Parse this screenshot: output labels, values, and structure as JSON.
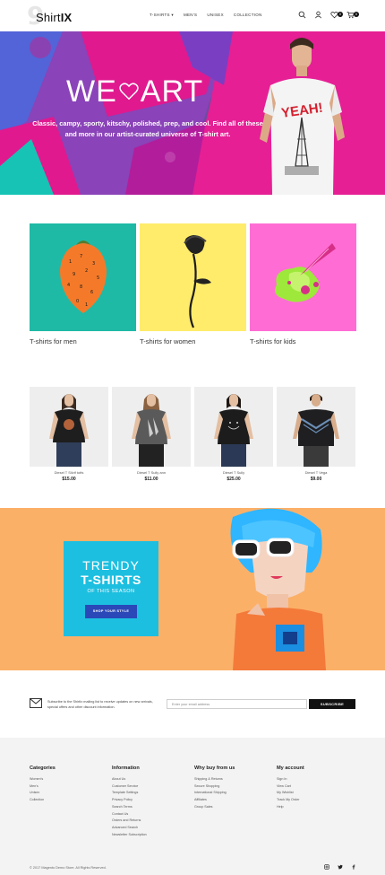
{
  "header": {
    "logo_number": "9",
    "logo_name": "Shirt",
    "logo_suffix": "IX",
    "nav": [
      "T-shirts",
      "Men's",
      "Unisex",
      "Collection"
    ],
    "cart_count": "0",
    "wishlist_count": "0"
  },
  "hero": {
    "title_left": "WE",
    "title_right": "ART",
    "text": "Classic, campy, sporty, kitschy, polished, prep, and cool. Find all of these and more in our artist-curated universe of T-shirt art.",
    "shirt_print": "YEAH!"
  },
  "categories": [
    {
      "label": "T-shirts for men"
    },
    {
      "label": "T-shirts for women"
    },
    {
      "label": "T-shirts for kids"
    }
  ],
  "products": [
    {
      "name": "Diesel T Silvif totfs",
      "price": "$15.00"
    },
    {
      "name": "Diesel T Sully ann",
      "price": "$11.00"
    },
    {
      "name": "Diesel T Sully",
      "price": "$25.00"
    },
    {
      "name": "Diesel T Vega",
      "price": "$9.00"
    }
  ],
  "promo": {
    "line1": "TRENDY",
    "line2": "T-SHIRTS",
    "line3": "OF THIS SEASON",
    "button": "SHOP YOUR STYLE"
  },
  "newsletter": {
    "text": "Subscribe to the ShirtIx mailing list to receive updates on new arrivals, special offers and other discount information.",
    "placeholder": "Enter your email address",
    "button": "SUBSCRIBE"
  },
  "footer": {
    "columns": [
      {
        "title": "Categories",
        "items": [
          "Women's",
          "Men's",
          "Unisex",
          "Collection"
        ]
      },
      {
        "title": "Information",
        "items": [
          "About Us",
          "Customer Service",
          "Template Settings",
          "Privacy Policy",
          "Search Terms",
          "Contact Us",
          "Orders and Returns",
          "Advanced Search",
          "Newsletter Subscription"
        ]
      },
      {
        "title": "Why buy from us",
        "items": [
          "Shipping & Returns",
          "Secure Shopping",
          "International Shipping",
          "Affiliates",
          "Group Sales"
        ]
      },
      {
        "title": "My account",
        "items": [
          "Sign In",
          "View Cart",
          "My Wishlist",
          "Track My Order",
          "Help"
        ]
      }
    ],
    "copyright": "© 2017 Magento Demo Store. All Rights Reserved."
  },
  "colors": {
    "hero_base": "#6d4ba1",
    "hero_magenta": "#e0198f",
    "hero_teal": "#16c3b4",
    "men_bg": "#1ebaa6",
    "women_bg": "#ffec6b",
    "kids_bg": "#ff6dd4",
    "promo_bg": "#fbb068",
    "promo_box": "#1dbfe0",
    "promo_button": "#2b48b8",
    "footer_bg": "#f3f3f3"
  }
}
